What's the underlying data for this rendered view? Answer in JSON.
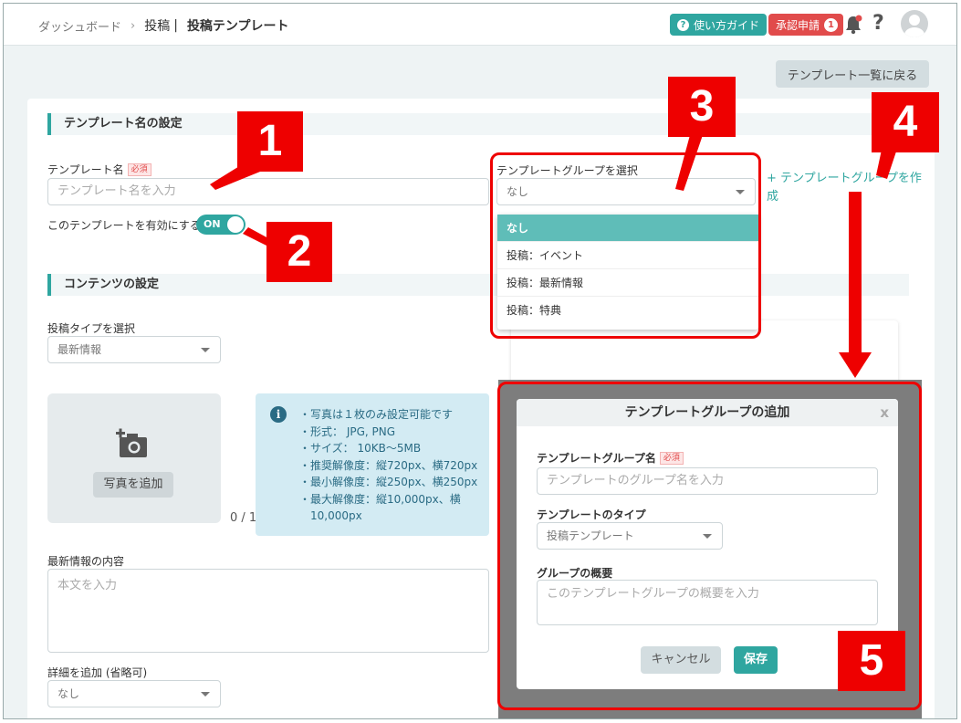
{
  "header": {
    "breadcrumb": [
      "ダッシュボード",
      "投稿",
      "投稿テンプレート"
    ],
    "guide_label": "使い方ガイド",
    "approve_label": "承認申請",
    "approve_count": "1"
  },
  "back_button": "テンプレート一覧に戻る",
  "template_section": {
    "title": "テンプレート名の設定",
    "name_label": "テンプレート名",
    "required": "必須",
    "name_placeholder": "テンプレート名を入力",
    "enable_label": "このテンプレートを有効にする",
    "toggle_label": "ON",
    "group_label": "テンプレートグループを選択",
    "group_value": "なし",
    "group_options": [
      "なし",
      "投稿：イベント",
      "投稿：最新情報",
      "投稿：特典"
    ],
    "create_group_link": "+ テンプレートグループを作成"
  },
  "content_section": {
    "title": "コンテンツの設定",
    "post_type_label": "投稿タイプを選択",
    "post_type_value": "最新情報",
    "photo_button": "写真を追加",
    "photo_count": "0 / 1",
    "info": [
      "・写真は１枚のみ設定可能です",
      "・形式： JPG, PNG",
      "・サイズ： 10KB～5MB",
      "・推奨解像度：縦720px、横720px",
      "・最小解像度：縦250px、横250px",
      "・最大解像度：縦10,000px、横",
      "　10,000px"
    ],
    "body_label": "最新情報の内容",
    "body_placeholder": "本文を入力",
    "detail_label": "詳細を追加 (省略可)",
    "detail_value": "なし"
  },
  "modal": {
    "title": "テンプレートグループの追加",
    "close": "x",
    "name_label": "テンプレートグループ名",
    "required": "必須",
    "name_placeholder": "テンプレートのグループ名を入力",
    "type_label": "テンプレートのタイプ",
    "type_value": "投稿テンプレート",
    "summary_label": "グループの概要",
    "summary_placeholder": "このテンプレートグループの概要を入力",
    "cancel": "キャンセル",
    "save": "保存"
  },
  "annotations": [
    "1",
    "2",
    "3",
    "4",
    "5"
  ],
  "colors": {
    "accent": "#2fa6a0",
    "danger": "#e14b4b",
    "annotation": "#ee0000"
  }
}
